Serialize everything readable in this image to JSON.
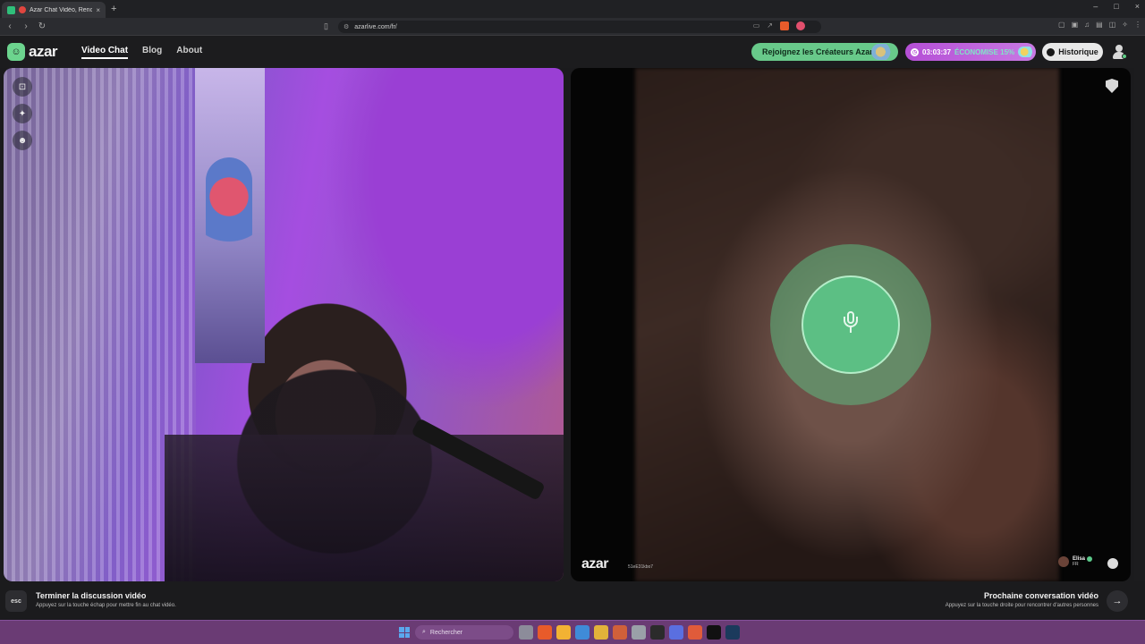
{
  "browser": {
    "tab_title": "Azar Chat Vidéo, Rencontre",
    "tab_close": "×",
    "new_tab": "+",
    "window_controls": [
      "–",
      "□",
      "×"
    ],
    "url": "azarlive.com/fr/",
    "nav": {
      "back": "‹",
      "forward": "›",
      "reload": "↻"
    }
  },
  "site": {
    "logo_text": "azar",
    "nav_links": [
      "Video Chat",
      "Blog",
      "About"
    ],
    "creators_button": "Rejoignez les Créateurs Azar",
    "promo": {
      "timer": "03:03:37",
      "save_label": "ÉCONOMISE 15%"
    },
    "history_button": "Historique"
  },
  "remote": {
    "watermark": "azar",
    "session_id": "51eE31kbo7",
    "peer_name": "Elisa",
    "peer_country": "FR"
  },
  "bottom": {
    "esc_key": "esc",
    "end_title": "Terminer la discussion vidéo",
    "end_subtitle": "Appuyez sur la touche échap pour mettre fin au chat vidéo.",
    "next_title": "Prochaine conversation vidéo",
    "next_subtitle": "Appuyez sur la touche droite pour rencontrer d'autres personnes",
    "next_arrow": "→"
  },
  "taskbar": {
    "search_placeholder": "Rechercher"
  },
  "colors": {
    "accent_green": "#5cbf84",
    "promo_purple": "#b54fd6",
    "taskbar": "#6a3b74"
  }
}
